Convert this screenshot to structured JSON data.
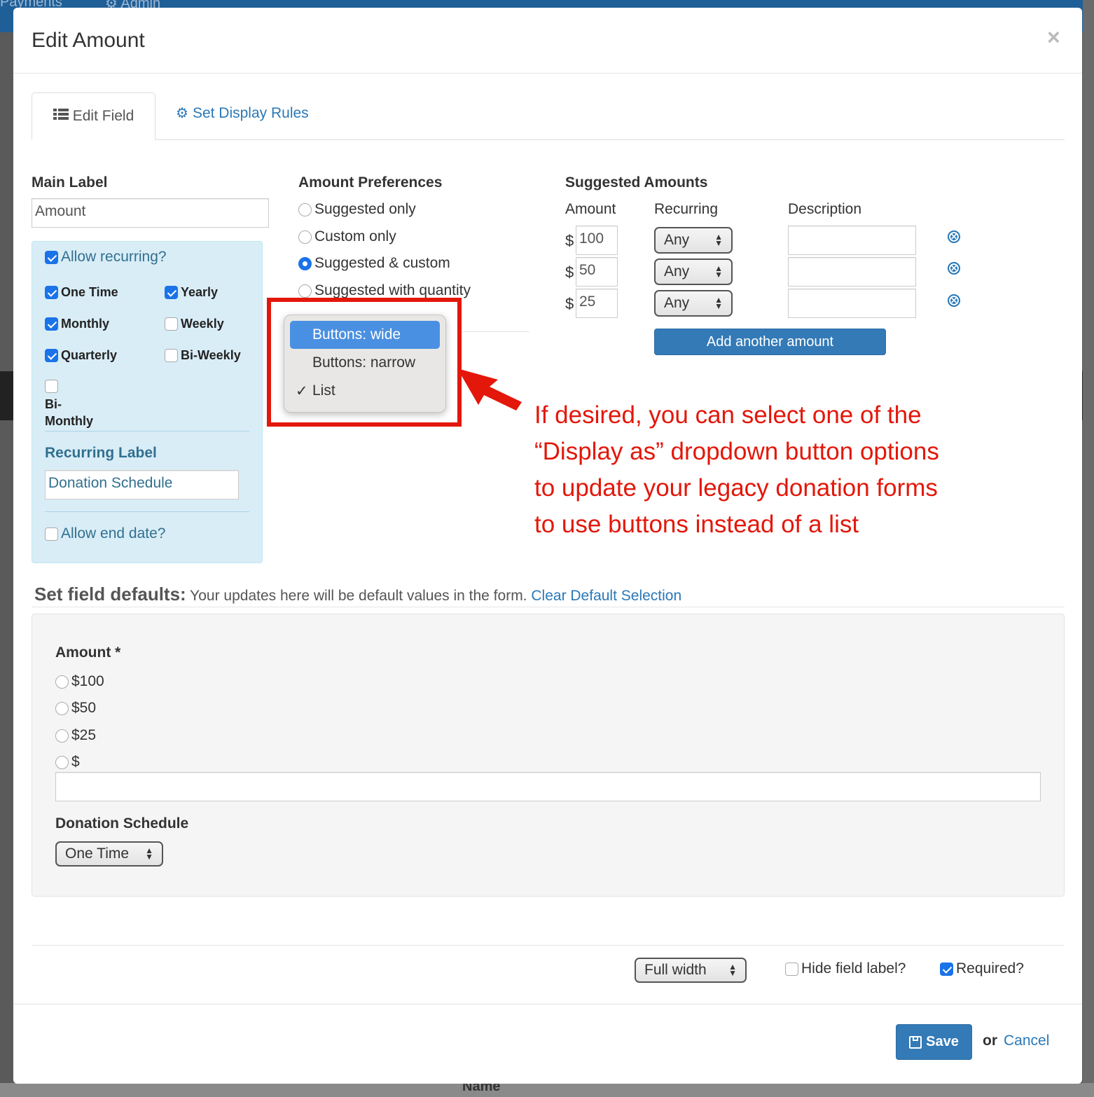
{
  "background": {
    "nav_left": "Payments",
    "nav_admin": "Admin",
    "name_label": "Name"
  },
  "modal": {
    "title": "Edit Amount",
    "close": "×",
    "tabs": [
      {
        "label": "Edit Field"
      },
      {
        "label": "Set Display Rules"
      }
    ]
  },
  "main_label": {
    "heading": "Main Label",
    "value": "Amount"
  },
  "recurring": {
    "allow_label": "Allow recurring?",
    "options": [
      {
        "label": "One Time",
        "checked": true
      },
      {
        "label": "Yearly",
        "checked": true
      },
      {
        "label": "Monthly",
        "checked": true
      },
      {
        "label": "Weekly",
        "checked": false
      },
      {
        "label": "Quarterly",
        "checked": true
      },
      {
        "label": "Bi-Weekly",
        "checked": false
      },
      {
        "label": "Bi-Monthly",
        "checked": false
      }
    ],
    "label_heading": "Recurring Label",
    "label_value": "Donation Schedule",
    "end_date_label": "Allow end date?"
  },
  "preferences": {
    "heading": "Amount Preferences",
    "options": [
      {
        "label": "Suggested only",
        "selected": false
      },
      {
        "label": "Custom only",
        "selected": false
      },
      {
        "label": "Suggested & custom",
        "selected": true
      },
      {
        "label": "Suggested with quantity",
        "selected": false
      }
    ]
  },
  "display_menu": {
    "options": [
      {
        "label": "Buttons: wide",
        "highlighted": true,
        "checked": false
      },
      {
        "label": "Buttons: narrow",
        "highlighted": false,
        "checked": false
      },
      {
        "label": "List",
        "highlighted": false,
        "checked": true
      }
    ],
    "checkmark": "✓"
  },
  "suggested": {
    "heading": "Suggested Amounts",
    "columns": [
      "Amount",
      "Recurring",
      "Description"
    ],
    "currency": "$",
    "rows": [
      {
        "amount": "100",
        "recurring": "Any",
        "description": ""
      },
      {
        "amount": "50",
        "recurring": "Any",
        "description": ""
      },
      {
        "amount": "25",
        "recurring": "Any",
        "description": ""
      }
    ],
    "add_button": "Add another amount"
  },
  "annotation": {
    "lines": [
      "If desired, you can select one of the",
      "“Display as” dropdown button options",
      "to update your legacy donation forms",
      "to use buttons instead of a list"
    ]
  },
  "defaults": {
    "heading": "Set field defaults:",
    "description": "Your updates here will be default values in the form.",
    "clear_link": "Clear Default Selection",
    "amount_label": "Amount *",
    "amount_options": [
      "$100",
      "$50",
      "$25",
      "$"
    ],
    "custom_value": "",
    "schedule_label": "Donation Schedule",
    "schedule_value": "One Time"
  },
  "footer_options": {
    "width_value": "Full width",
    "hide_label": "Hide field label?",
    "hide_checked": false,
    "required_label": "Required?",
    "required_checked": true
  },
  "actions": {
    "save": "Save",
    "or": "or",
    "cancel": "Cancel"
  },
  "colors": {
    "accent": "#337ab7",
    "annotation_red": "#e3170a",
    "info_bg": "#d9edf7"
  }
}
